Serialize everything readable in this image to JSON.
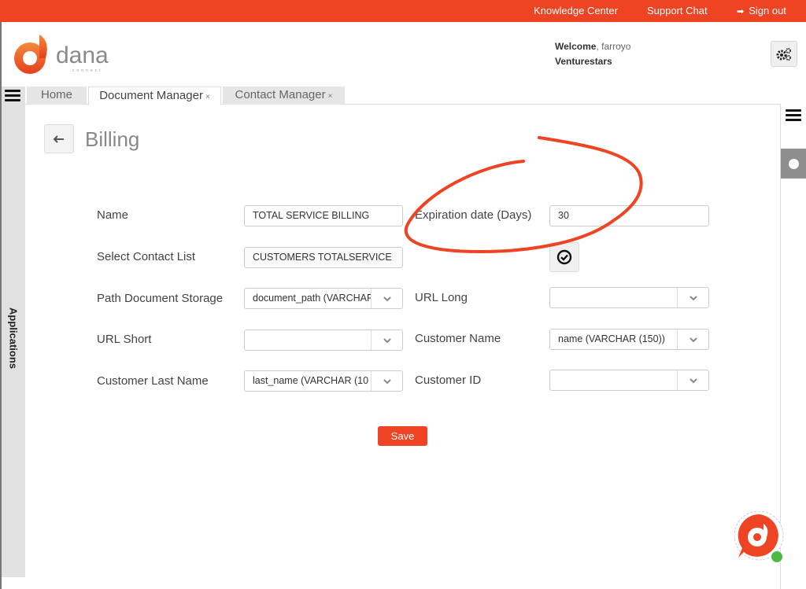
{
  "topbar": {
    "links": [
      {
        "label": "Knowledge Center"
      },
      {
        "label": "Support Chat"
      },
      {
        "label": "Sign out",
        "icon": "sign-out-icon"
      }
    ],
    "color": "#ee4423"
  },
  "header": {
    "logo_text": "dana",
    "logo_subtext": "connect",
    "welcome_label": "Welcome",
    "welcome_user": ", farroyo",
    "company": "Venturestars",
    "settings_icon": "gears-icon"
  },
  "sidebar": {
    "menu_icon": "hamburger-icon",
    "label": "Applications"
  },
  "tabs": [
    {
      "label": "Home",
      "closable": false,
      "active": false
    },
    {
      "label": "Document Manager",
      "closable": true,
      "active": true
    },
    {
      "label": "Contact Manager",
      "closable": true,
      "active": false
    }
  ],
  "tab_close_glyph": "×",
  "page": {
    "back_icon": "back-arrow-icon",
    "title": "Billing"
  },
  "form": {
    "name": {
      "label": "Name",
      "value": "TOTAL SERVICE BILLING"
    },
    "expiration": {
      "label": "Expiration date (Days)",
      "value": "30"
    },
    "contact_list": {
      "label": "Select Contact List",
      "value": "CUSTOMERS TOTALSERVICE"
    },
    "path_document_storage": {
      "label": "Path Document Storage",
      "value": "document_path (VARCHAR"
    },
    "url_long": {
      "label": "URL Long",
      "value": ""
    },
    "url_short": {
      "label": "URL Short",
      "value": ""
    },
    "customer_name": {
      "label": "Customer Name",
      "value": "name (VARCHAR (150))"
    },
    "customer_last_name": {
      "label": "Customer Last Name",
      "value": "last_name (VARCHAR (10"
    },
    "customer_id": {
      "label": "Customer ID",
      "value": ""
    },
    "save_label": "Save"
  },
  "accent": "#ee4423",
  "chat_status_color": "#4cb944"
}
